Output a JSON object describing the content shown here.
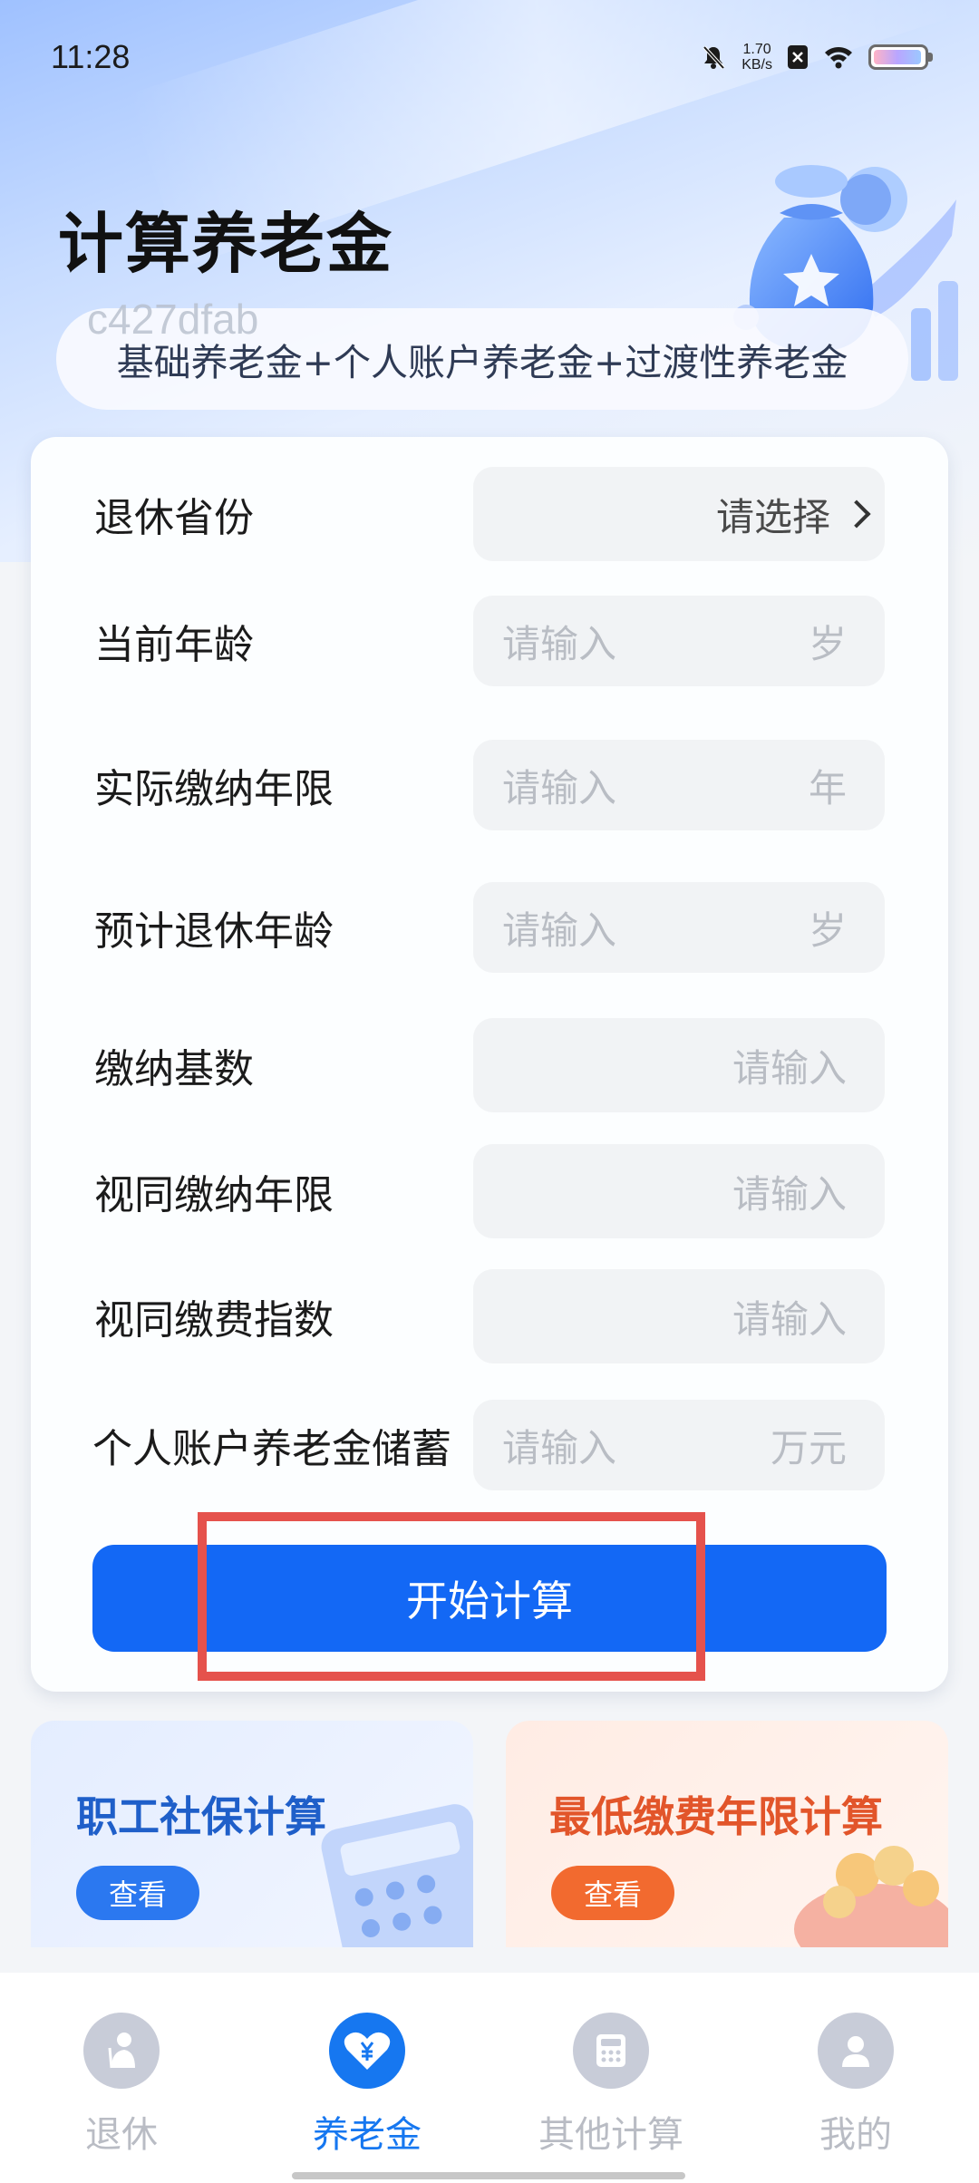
{
  "status_bar": {
    "time": "11:28",
    "net_speed_value": "1.70",
    "net_speed_unit": "KB/s"
  },
  "header": {
    "title": "计算养老金",
    "watermark": "c427dfab",
    "formula": "基础养老金+个人账户养老金+过渡性养老金"
  },
  "form": {
    "rows": [
      {
        "label": "退休省份",
        "value": "请选择",
        "unit": ""
      },
      {
        "label": "当前年龄",
        "value": "请输入",
        "unit": "岁"
      },
      {
        "label": "实际缴纳年限",
        "value": "请输入",
        "unit": "年"
      },
      {
        "label": "预计退休年龄",
        "value": "请输入",
        "unit": "岁"
      },
      {
        "label": "缴纳基数",
        "value": "请输入",
        "unit": ""
      },
      {
        "label": "视同缴纳年限",
        "value": "请输入",
        "unit": ""
      },
      {
        "label": "视同缴费指数",
        "value": "请输入",
        "unit": ""
      },
      {
        "label": "个人账户养老金储蓄",
        "value": "请输入",
        "unit": "万元"
      }
    ],
    "submit_label": "开始计算"
  },
  "promos": [
    {
      "title": "职工社保计算",
      "button": "查看"
    },
    {
      "title": "最低缴费年限计算",
      "button": "查看"
    }
  ],
  "tabs": [
    {
      "label": "退休",
      "icon": "retire-icon",
      "active": false
    },
    {
      "label": "养老金",
      "icon": "pension-heart-icon",
      "active": true
    },
    {
      "label": "其他计算",
      "icon": "calculator-icon",
      "active": false
    },
    {
      "label": "我的",
      "icon": "profile-icon",
      "active": false
    }
  ],
  "colors": {
    "accent": "#1368f5",
    "highlight": "#e5524c",
    "promo_blue": "#1f5fc9",
    "promo_orange": "#e2552a"
  }
}
